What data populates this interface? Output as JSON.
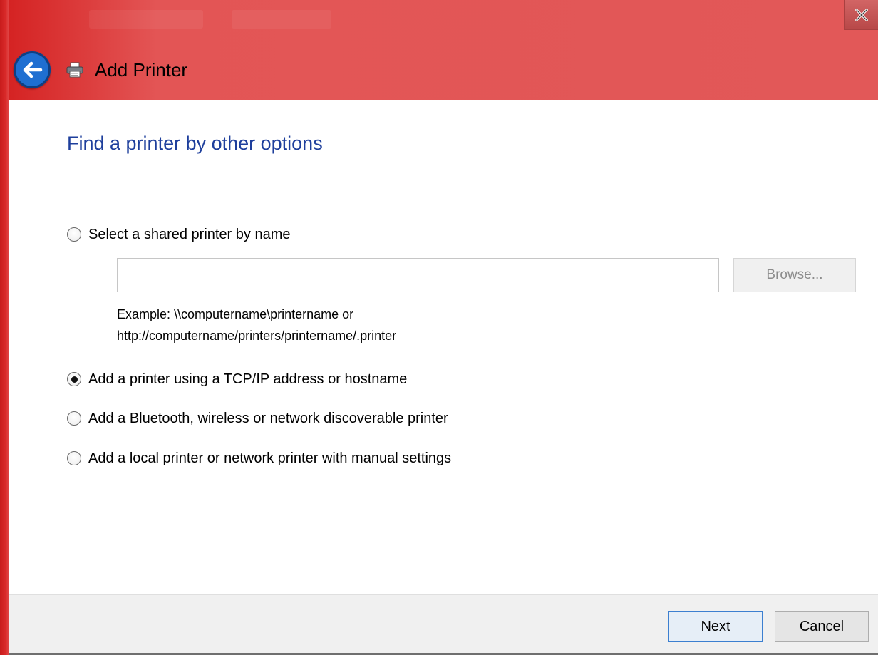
{
  "window": {
    "title": "Add Printer",
    "close_label": "X"
  },
  "colors": {
    "header": "#e25858",
    "frame": "#c81c1c",
    "heading": "#1e3f9c",
    "back_button": "#1f6fd1"
  },
  "icons": {
    "back": "back-arrow-icon",
    "printer": "printer-icon",
    "close": "close-icon"
  },
  "main": {
    "heading": "Find a printer by other options",
    "options": [
      {
        "label": "Select a shared printer by name",
        "selected": false
      },
      {
        "label": "Add a printer using a TCP/IP address or hostname",
        "selected": true
      },
      {
        "label": "Add a Bluetooth, wireless or network discoverable printer",
        "selected": false
      },
      {
        "label": "Add a local printer or network printer with manual settings",
        "selected": false
      }
    ],
    "shared_printer_input": {
      "value": "",
      "placeholder": ""
    },
    "browse_label": "Browse...",
    "example_line1": "Example: \\\\computername\\printername or",
    "example_line2": "http://computername/printers/printername/.printer"
  },
  "footer": {
    "next_label": "Next",
    "cancel_label": "Cancel"
  }
}
